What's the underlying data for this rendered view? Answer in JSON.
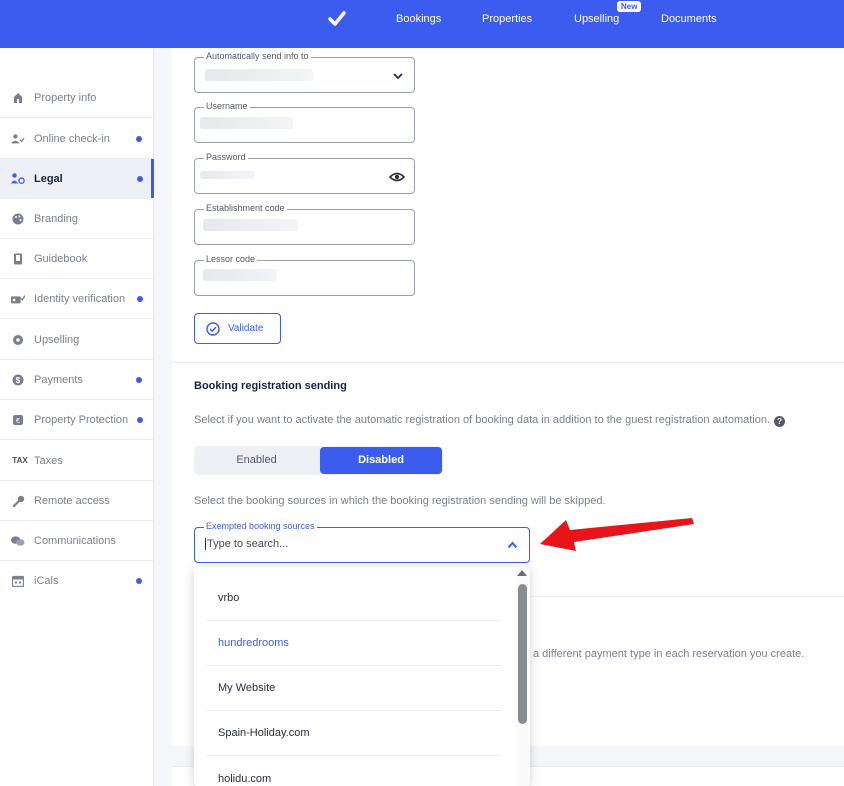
{
  "topnav": {
    "items": [
      "Bookings",
      "Properties",
      "Upselling",
      "Documents"
    ],
    "new_badge": "New",
    "logo_icon": "checkmark-icon"
  },
  "sidebar": {
    "items": [
      {
        "label": "Property info",
        "icon": "house-icon",
        "dot": false
      },
      {
        "label": "Online check-in",
        "icon": "user-check-icon",
        "dot": true
      },
      {
        "label": "Legal",
        "icon": "legal-icon",
        "dot": true,
        "active": true
      },
      {
        "label": "Branding",
        "icon": "palette-icon",
        "dot": false
      },
      {
        "label": "Guidebook",
        "icon": "book-icon",
        "dot": false
      },
      {
        "label": "Identity verification",
        "icon": "id-card-icon",
        "dot": true
      },
      {
        "label": "Upselling",
        "icon": "gear-icon",
        "dot": false
      },
      {
        "label": "Payments",
        "icon": "dollar-icon",
        "dot": true
      },
      {
        "label": "Property Protection",
        "icon": "shield-icon",
        "dot": true
      },
      {
        "label": "Taxes",
        "icon": "tax-icon",
        "dot": false
      },
      {
        "label": "Remote access",
        "icon": "key-icon",
        "dot": false
      },
      {
        "label": "Communications",
        "icon": "chat-icon",
        "dot": false
      },
      {
        "label": "iCals",
        "icon": "calendar-icon",
        "dot": true
      }
    ],
    "tax_glyph": "TAX"
  },
  "form": {
    "auto_send_label": "Automatically send info to",
    "username_label": "Username",
    "password_label": "Password",
    "establishment_label": "Establishment code",
    "lessor_label": "Lessor code",
    "validate_label": "Validate"
  },
  "booking_registration": {
    "title": "Booking registration sending",
    "description": "Select if you want to activate the automatic registration of booking data in addition to the guest registration automation.",
    "help_glyph": "?",
    "toggle": {
      "enabled": "Enabled",
      "disabled": "Disabled",
      "selected": "Disabled"
    },
    "sources_description": "Select the booking sources in which the booking registration sending will be skipped.",
    "exempted_label": "Exempted booking sources",
    "search_placeholder": "Type to search...",
    "options": [
      "vrbo",
      "hundredrooms",
      "My Website",
      "Spain-Holiday.com",
      "holidu.com"
    ],
    "hovered_option": "hundredrooms"
  },
  "behind_text": "a different payment type in each reservation you create.",
  "colors": {
    "primary": "#3c5cf0",
    "arrow": "#e8141a"
  }
}
